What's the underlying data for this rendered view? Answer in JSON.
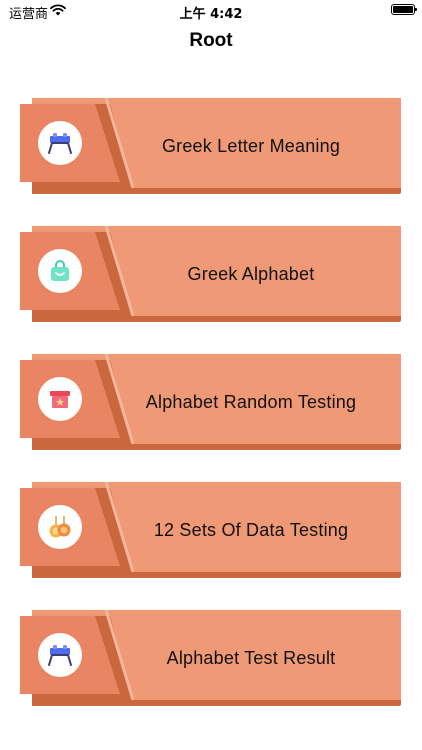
{
  "status_bar": {
    "carrier": "运营商",
    "time": "上午 4:42"
  },
  "nav": {
    "title": "Root"
  },
  "menu": [
    {
      "label": "Greek Letter Meaning",
      "icon": "table-icon"
    },
    {
      "label": "Greek Alphabet",
      "icon": "shopping-bag-icon"
    },
    {
      "label": "Alphabet Random Testing",
      "icon": "gift-box-icon"
    },
    {
      "label": "12 Sets Of Data Testing",
      "icon": "coins-icon"
    },
    {
      "label": "Alphabet Test Result",
      "icon": "table-icon"
    }
  ],
  "colors": {
    "card": "#ef9976",
    "card_dark": "#e98563",
    "card_shadow": "#c9683f",
    "stripe": "#f6b79c"
  }
}
